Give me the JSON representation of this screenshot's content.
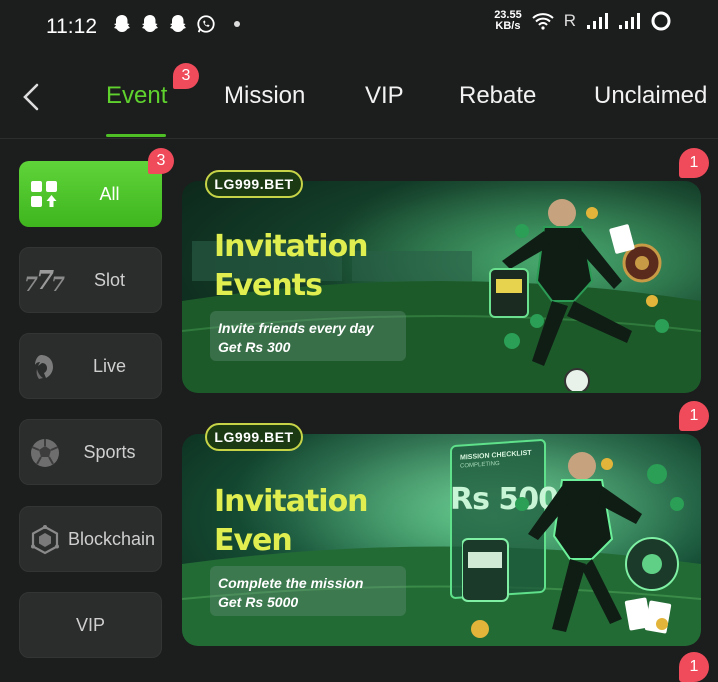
{
  "status_bar": {
    "time": "11:12",
    "speed_value": "23.55",
    "speed_unit": "KB/s",
    "roaming": "R",
    "icons": [
      "snapchat-icon",
      "snapchat-icon",
      "snapchat-icon",
      "whatsapp-icon",
      "dot",
      "wifi-icon",
      "signal-icon",
      "signal-icon",
      "battery-ring-icon"
    ]
  },
  "nav": {
    "tabs": [
      {
        "label": "Event",
        "badge": "3",
        "active": true
      },
      {
        "label": "Mission"
      },
      {
        "label": "VIP"
      },
      {
        "label": "Rebate"
      },
      {
        "label": "Unclaimed"
      }
    ]
  },
  "sidebar": {
    "items": [
      {
        "label": "All",
        "badge": "3",
        "icon": "grid-icon",
        "active": true
      },
      {
        "label": "Slot",
        "icon": "slot-777-icon"
      },
      {
        "label": "Live",
        "icon": "live-dealer-icon"
      },
      {
        "label": "Sports",
        "icon": "football-icon"
      },
      {
        "label": "Blockchain",
        "icon": "blockchain-cube-icon"
      },
      {
        "label": "VIP"
      }
    ]
  },
  "banners": [
    {
      "brand": "LG999.BET",
      "title_line1": "Invitation",
      "title_line2": "Events",
      "subtitle_line1": "Invite friends every day",
      "subtitle_line2": "Get Rs 300",
      "badge": "1"
    },
    {
      "brand": "LG999.BET",
      "title_line1": "Invitation",
      "title_line2": "Even",
      "subtitle_line1": "Complete the mission",
      "subtitle_line2": "Get Rs 5000",
      "badge": "1",
      "card_title": "MISSION CHECKLIST",
      "card_sub": "COMPLETING",
      "card_amount": "Rs 5000"
    }
  ],
  "peek_badge": "1",
  "colors": {
    "accent": "#4ec026",
    "badge": "#ef4b5b",
    "bg": "#1c1d1d"
  }
}
